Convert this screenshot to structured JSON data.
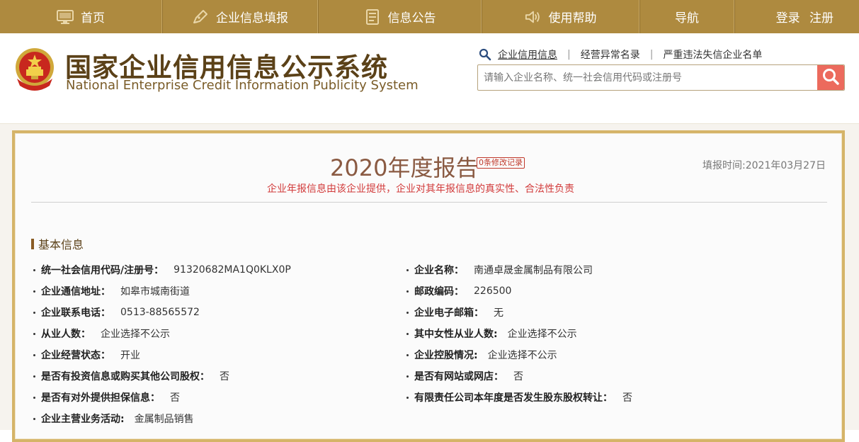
{
  "nav": {
    "items": [
      {
        "label": "首页",
        "icon": "monitor-icon"
      },
      {
        "label": "企业信息填报",
        "icon": "pen-icon"
      },
      {
        "label": "信息公告",
        "icon": "document-icon"
      },
      {
        "label": "使用帮助",
        "icon": "speaker-icon"
      },
      {
        "label": "导航",
        "icon": ""
      }
    ],
    "login": "登录",
    "register": "注册"
  },
  "header": {
    "title_cn": "国家企业信用信息公示系统",
    "title_en": "National Enterprise Credit Information Publicity System"
  },
  "search": {
    "links": [
      "企业信用信息",
      "经营异常名录",
      "严重违法失信企业名单"
    ],
    "placeholder": "请输入企业名称、统一社会信用代码或注册号"
  },
  "report": {
    "title": "2020年度报告",
    "modify_badge": "0条修改记录",
    "fill_time": "填报时间:2021年03月27日",
    "disclaimer": "企业年报信息由该企业提供，企业对其年报信息的真实性、合法性负责"
  },
  "basic_info": {
    "section_title": "基本信息",
    "rows": [
      {
        "left": {
          "label": "统一社会信用代码/注册号：",
          "value": "91320682MA1Q0KLX0P"
        },
        "right": {
          "label": "企业名称：",
          "value": "南通卓晟金属制品有限公司"
        }
      },
      {
        "left": {
          "label": "企业通信地址：",
          "value": "如皋市城南街道"
        },
        "right": {
          "label": "邮政编码：",
          "value": "226500"
        }
      },
      {
        "left": {
          "label": "企业联系电话：",
          "value": "0513-88565572"
        },
        "right": {
          "label": "企业电子邮箱：",
          "value": "无"
        }
      },
      {
        "left": {
          "label": "从业人数：",
          "value": "企业选择不公示"
        },
        "right": {
          "label": "其中女性从业人数:",
          "value": "企业选择不公示"
        }
      },
      {
        "left": {
          "label": "企业经营状态：",
          "value": "开业"
        },
        "right": {
          "label": "企业控股情况:",
          "value": "企业选择不公示"
        }
      },
      {
        "left": {
          "label": "是否有投资信息或购买其他公司股权：",
          "value": "否"
        },
        "right": {
          "label": "是否有网站或网店：",
          "value": "否"
        }
      },
      {
        "left": {
          "label": "是否有对外提供担保信息：",
          "value": "否"
        },
        "right": {
          "label": "有限责任公司本年度是否发生股东股权转让：",
          "value": "否"
        }
      },
      {
        "left": {
          "label": "企业主营业务活动:",
          "value": "金属制品销售"
        }
      }
    ]
  },
  "colors": {
    "nav_bg": "#ae8a3f",
    "title_brown": "#5b4118",
    "search_button": "#ec6a5d",
    "panel_border": "#d5b468",
    "disclaimer_red": "#d23b3b"
  }
}
